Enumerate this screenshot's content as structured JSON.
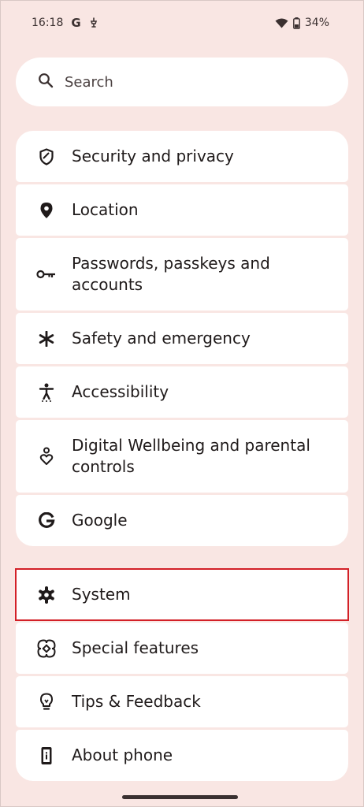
{
  "status_bar": {
    "time": "16:18",
    "carrier_glyph": "G",
    "battery": "34%",
    "icons": [
      "google-icon",
      "notification-icon",
      "wifi-icon",
      "battery-icon"
    ]
  },
  "search": {
    "placeholder": "Search",
    "icon": "search-icon"
  },
  "settings": {
    "group1": [
      {
        "label": "Security and privacy",
        "icon": "shield-icon"
      },
      {
        "label": "Location",
        "icon": "location-pin-icon"
      },
      {
        "label": "Passwords, passkeys and accounts",
        "icon": "key-icon"
      },
      {
        "label": "Safety and emergency",
        "icon": "asterisk-icon"
      },
      {
        "label": "Accessibility",
        "icon": "accessibility-icon"
      },
      {
        "label": "Digital Wellbeing and parental controls",
        "icon": "wellbeing-icon"
      },
      {
        "label": "Google",
        "icon": "google-icon"
      }
    ],
    "group2": [
      {
        "label": "System",
        "icon": "gear-icon",
        "selected": true
      },
      {
        "label": "Special features",
        "icon": "special-features-icon"
      },
      {
        "label": "Tips & Feedback",
        "icon": "lightbulb-icon"
      },
      {
        "label": "About phone",
        "icon": "phone-info-icon"
      }
    ]
  },
  "colors": {
    "background": "#f9e6e3",
    "card": "#ffffff",
    "highlight": "#d32027",
    "text": "#1f1a1a"
  }
}
